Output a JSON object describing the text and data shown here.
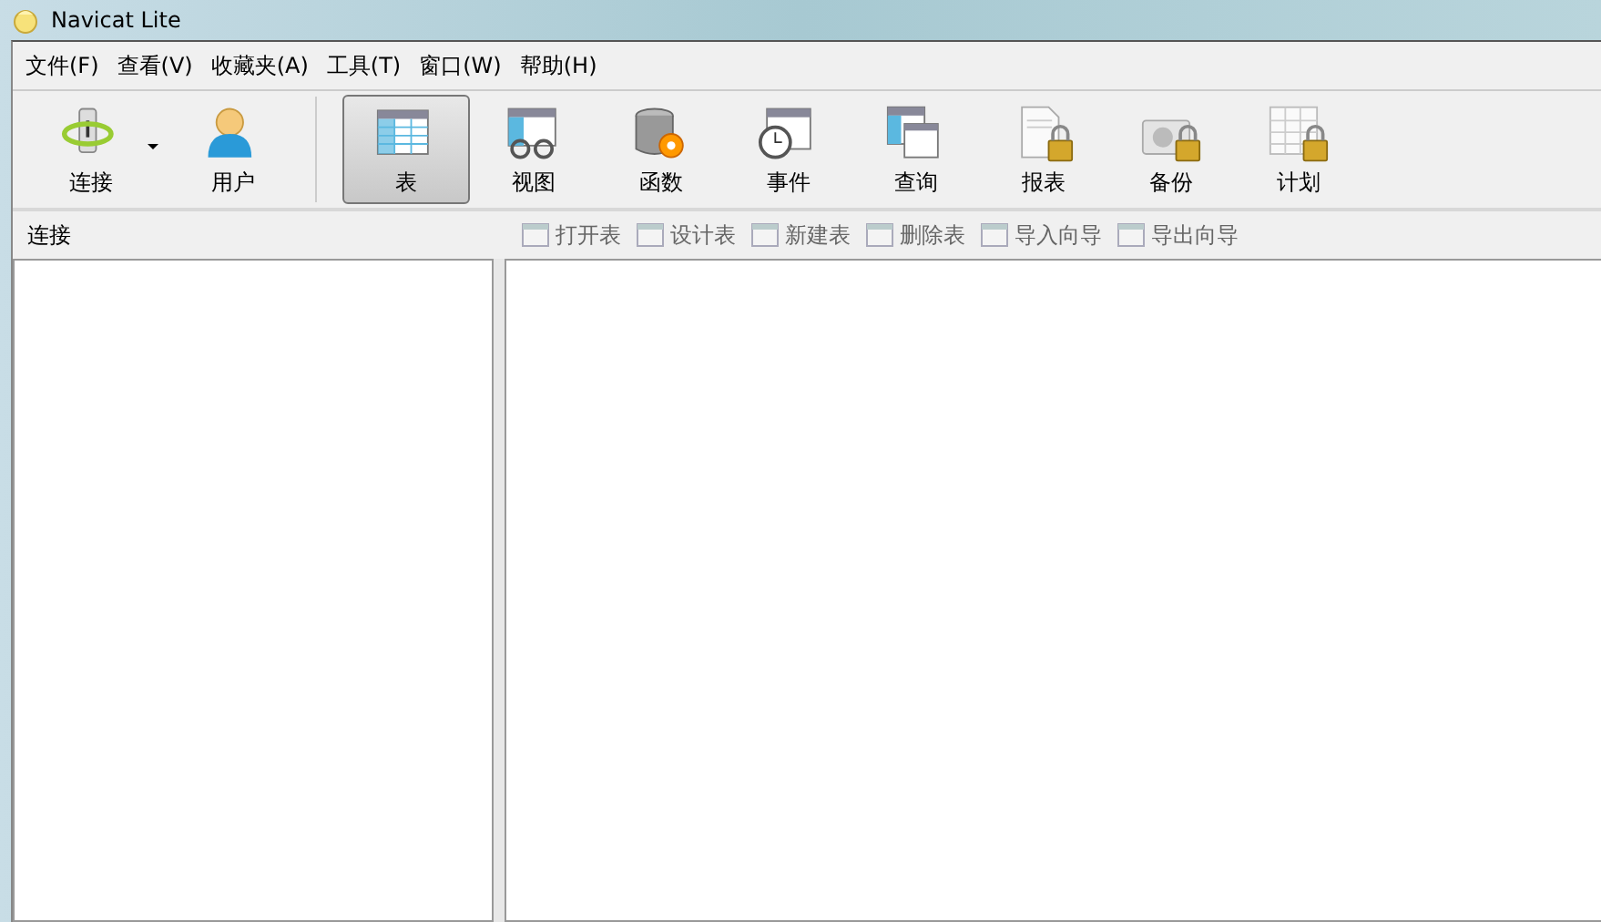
{
  "window": {
    "title": "Navicat Lite"
  },
  "menu": [
    {
      "label": "文件(F)"
    },
    {
      "label": "查看(V)"
    },
    {
      "label": "收藏夹(A)"
    },
    {
      "label": "工具(T)"
    },
    {
      "label": "窗口(W)"
    },
    {
      "label": "帮助(H)"
    }
  ],
  "toolbar_left": [
    {
      "label": "连接",
      "kind": "connection",
      "dropdown": true
    },
    {
      "label": "用户",
      "kind": "user",
      "dropdown": false
    }
  ],
  "toolbar": [
    {
      "label": "表",
      "kind": "table",
      "selected": true,
      "locked": false
    },
    {
      "label": "视图",
      "kind": "view",
      "selected": false,
      "locked": false
    },
    {
      "label": "函数",
      "kind": "function",
      "selected": false,
      "locked": false
    },
    {
      "label": "事件",
      "kind": "event",
      "selected": false,
      "locked": false
    },
    {
      "label": "查询",
      "kind": "query",
      "selected": false,
      "locked": false
    },
    {
      "label": "报表",
      "kind": "report",
      "selected": false,
      "locked": true
    },
    {
      "label": "备份",
      "kind": "backup",
      "selected": false,
      "locked": true
    },
    {
      "label": "计划",
      "kind": "schedule",
      "selected": false,
      "locked": true
    }
  ],
  "connection_pane": {
    "title": "连接"
  },
  "object_toolbar": [
    {
      "label": "打开表",
      "disabled": true
    },
    {
      "label": "设计表",
      "disabled": true
    },
    {
      "label": "新建表",
      "disabled": true
    },
    {
      "label": "删除表",
      "disabled": true
    },
    {
      "label": "导入向导",
      "disabled": true
    },
    {
      "label": "导出向导",
      "disabled": true
    }
  ]
}
